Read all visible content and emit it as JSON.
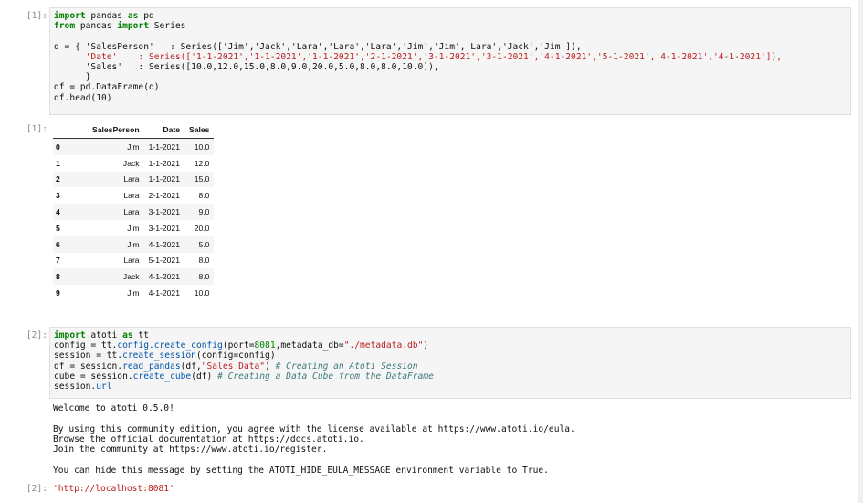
{
  "cell1": {
    "prompt": "[1]:",
    "out_prompt": "[1]:",
    "line1_kw1": "import",
    "line1_mod": " pandas ",
    "line1_kw2": "as",
    "line1_alias": " pd",
    "line2_kw1": "from",
    "line2_mod": " pandas ",
    "line2_kw2": "import",
    "line2_name": " Series",
    "d_line1": "d = { 'SalesPerson'   : Series(['Jim','Jack','Lara','Lara','Lara','Jim','Jim','Lara','Jack','Jim']),",
    "d_line2": "      'Date'    : Series(['1-1-2021','1-1-2021','1-1-2021','2-1-2021','3-1-2021','3-1-2021','4-1-2021','5-1-2021','4-1-2021','4-1-2021']),",
    "d_line3": "      'Sales'   : Series([10.0,12.0,15.0,8.0,9.0,20.0,5.0,8.0,8.0,10.0]),",
    "d_line4": "      }",
    "df_line": "df = pd.DataFrame(d)",
    "head_line": "df.head(10)"
  },
  "table": {
    "headers": [
      "",
      "SalesPerson",
      "Date",
      "Sales"
    ],
    "rows": [
      {
        "idx": "0",
        "person": "Jim",
        "date": "1-1-2021",
        "sales": "10.0"
      },
      {
        "idx": "1",
        "person": "Jack",
        "date": "1-1-2021",
        "sales": "12.0"
      },
      {
        "idx": "2",
        "person": "Lara",
        "date": "1-1-2021",
        "sales": "15.0"
      },
      {
        "idx": "3",
        "person": "Lara",
        "date": "2-1-2021",
        "sales": "8.0"
      },
      {
        "idx": "4",
        "person": "Lara",
        "date": "3-1-2021",
        "sales": "9.0"
      },
      {
        "idx": "5",
        "person": "Jim",
        "date": "3-1-2021",
        "sales": "20.0"
      },
      {
        "idx": "6",
        "person": "Jim",
        "date": "4-1-2021",
        "sales": "5.0"
      },
      {
        "idx": "7",
        "person": "Lara",
        "date": "5-1-2021",
        "sales": "8.0"
      },
      {
        "idx": "8",
        "person": "Jack",
        "date": "4-1-2021",
        "sales": "8.0"
      },
      {
        "idx": "9",
        "person": "Jim",
        "date": "4-1-2021",
        "sales": "10.0"
      }
    ]
  },
  "cell2": {
    "prompt": "[2]:",
    "out_prompt": "[2]:",
    "line1_kw1": "import",
    "line1_mod": " atoti ",
    "line1_kw2": "as",
    "line1_alias": " tt",
    "line2_pre": "config = tt.",
    "line2_fn": "config.create_config",
    "line2_args_a": "(port=",
    "line2_port": "8081",
    "line2_args_b": ",metadata_db=",
    "line2_str": "\"./metadata.db\"",
    "line2_end": ")",
    "line3_pre": "session = tt.",
    "line3_fn": "create_session",
    "line3_args": "(config=config)",
    "line4_pre": "df = session.",
    "line4_fn": "read_pandas",
    "line4_args_a": "(df,",
    "line4_str": "\"Sales Data\"",
    "line4_args_b": ") ",
    "line4_cm": "# Creating an Atoti Session",
    "line5_pre": "cube = session.",
    "line5_fn": "create_cube",
    "line5_args": "(df) ",
    "line5_cm": "# Creating a Data Cube from the DataFrame",
    "line6_pre": "session.",
    "line6_attr": "url",
    "stdout1": "Welcome to atoti 0.5.0!",
    "stdout2": "By using this community edition, you agree with the license available at https://www.atoti.io/eula.",
    "stdout3": "Browse the official documentation at https://docs.atoti.io.",
    "stdout4": "Join the community at https://www.atoti.io/register.",
    "stdout5": "You can hide this message by setting the ATOTI_HIDE_EULA_MESSAGE environment variable to True.",
    "result": "'http://localhost:8081'"
  }
}
